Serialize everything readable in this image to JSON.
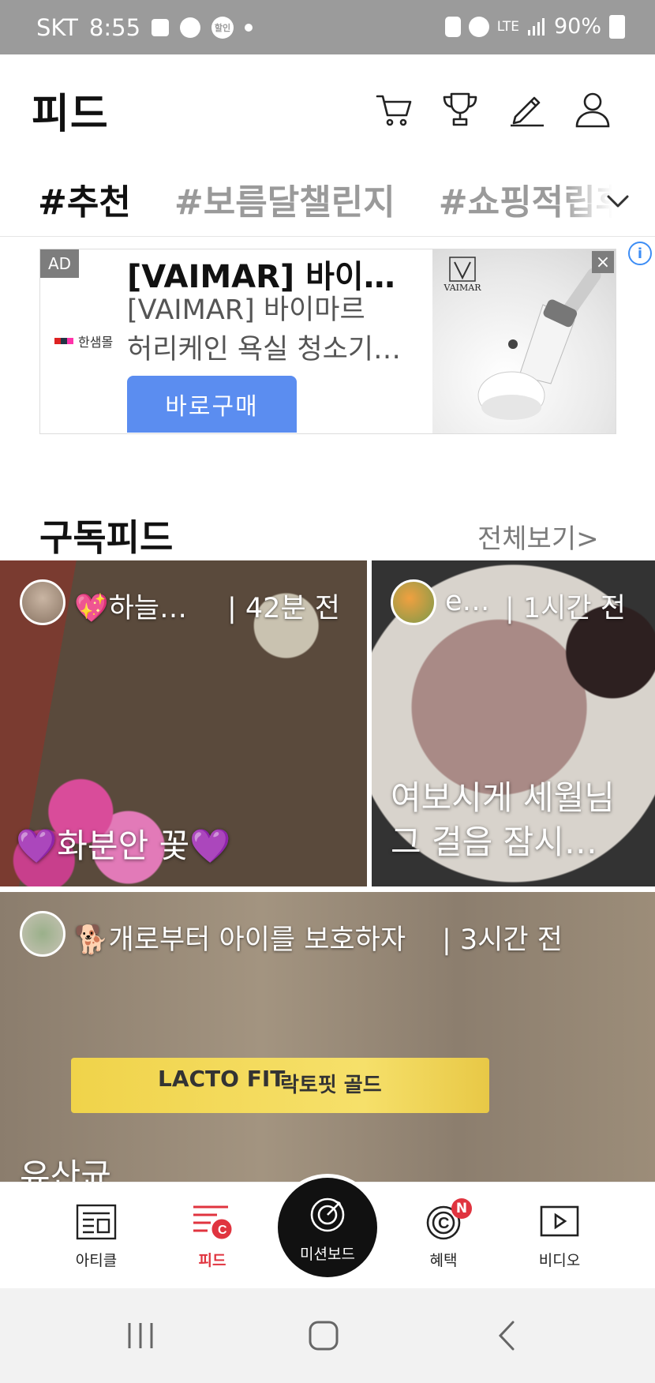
{
  "status_bar": {
    "carrier": "SKT",
    "time": "8:55",
    "badge_text": "할인",
    "network": "LTE",
    "battery": "90%"
  },
  "header": {
    "title": "피드",
    "icons": [
      "cart-icon",
      "trophy-icon",
      "pencil-icon",
      "profile-icon"
    ]
  },
  "tabs": [
    {
      "label": "#추천",
      "active": true
    },
    {
      "label": "#보름달챌린지",
      "active": false
    },
    {
      "label": "#쇼핑적립후기",
      "active": false
    }
  ],
  "ad": {
    "label": "AD",
    "brand": "한샘몰",
    "title": "[VAIMAR] 바이…",
    "desc_line1": "[VAIMAR] 바이마르",
    "desc_line2": "허리케인 욕실 청소기…",
    "button": "바로구매",
    "image_brand": "VAIMAR",
    "close": "×",
    "info": "i"
  },
  "subscription": {
    "title": "구독피드",
    "see_all": "전체보기>"
  },
  "cards": [
    {
      "user": "💖하늘…",
      "time": "| 42분 전",
      "caption": "💜화분안 꽃💜"
    },
    {
      "user": "e…",
      "time": "| 1시간 전",
      "caption_line1": "여보시게 세월님",
      "caption_line2": "그 걸음 잠시…"
    },
    {
      "user": "🐕개로부터 아이를 보호하자",
      "time": "| 3시간 전",
      "caption": "유산균",
      "product_logo": "LACTO FIT",
      "product_name": "락토핏 골드"
    }
  ],
  "bottom_nav": [
    {
      "label": "아티클",
      "icon": "article-icon"
    },
    {
      "label": "피드",
      "icon": "feed-icon",
      "active": true
    },
    {
      "label": "미션보드",
      "icon": "target-icon"
    },
    {
      "label": "혜택",
      "icon": "benefit-icon",
      "badge": "N"
    },
    {
      "label": "비디오",
      "icon": "video-icon"
    }
  ],
  "colors": {
    "accent": "#e0343f",
    "ad_button": "#5b8df0",
    "status_bar": "#9b9b9b"
  }
}
